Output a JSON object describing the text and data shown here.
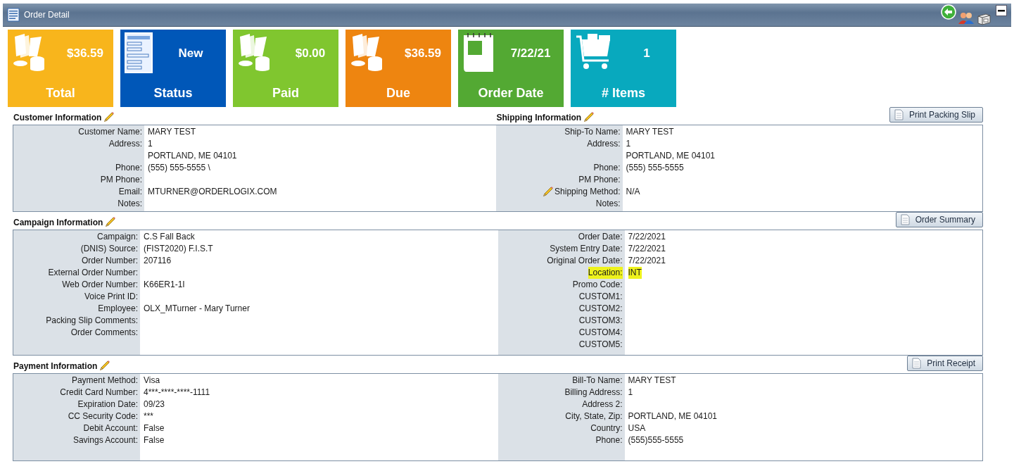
{
  "window": {
    "title": "Order Detail"
  },
  "tiles": [
    {
      "kind": "money",
      "value": "$36.59",
      "label": "Total",
      "color": "#f8b51c"
    },
    {
      "kind": "form",
      "value": "New",
      "label": "Status",
      "color": "#0057b8"
    },
    {
      "kind": "money",
      "value": "$0.00",
      "label": "Paid",
      "color": "#80c62f"
    },
    {
      "kind": "money",
      "value": "$36.59",
      "label": "Due",
      "color": "#ee8510"
    },
    {
      "kind": "calendar",
      "value": "7/22/21",
      "label": "Order Date",
      "color": "#53a933"
    },
    {
      "kind": "cart",
      "value": "1",
      "label": "# Items",
      "color": "#08a9be"
    }
  ],
  "blocks": [
    {
      "kind": "split",
      "columns": [
        {
          "title": "Customer Information",
          "fields": [
            {
              "label": "Customer Name:",
              "lines": [
                "MARY TEST"
              ],
              "editable": false,
              "highlighted": false
            },
            {
              "label": "Address:",
              "lines": [
                "1",
                "PORTLAND, ME 04101"
              ],
              "editable": false,
              "highlighted": false
            },
            {
              "label": "Phone:",
              "lines": [
                "(555) 555-5555 \\"
              ],
              "editable": false,
              "highlighted": false
            },
            {
              "label": "PM Phone:",
              "editable": false,
              "highlighted": false
            },
            {
              "label": "Email:",
              "lines": [
                "MTURNER@ORDERLOGIX.COM"
              ],
              "editable": false,
              "highlighted": false
            },
            {
              "label": "Notes:",
              "editable": false,
              "highlighted": false
            }
          ]
        },
        {
          "title": "Shipping Information",
          "button": "Print Packing Slip",
          "fields": [
            {
              "label": "Ship-To Name:",
              "lines": [
                "MARY TEST"
              ],
              "editable": false,
              "highlighted": false
            },
            {
              "label": "Address:",
              "lines": [
                "1",
                "PORTLAND, ME 04101"
              ],
              "editable": false,
              "highlighted": false
            },
            {
              "label": "Phone:",
              "lines": [
                "(555) 555-5555"
              ],
              "editable": false,
              "highlighted": false
            },
            {
              "label": "PM Phone:",
              "editable": false,
              "highlighted": false
            },
            {
              "label": "Shipping Method:",
              "lines": [
                "N/A"
              ],
              "editable": true,
              "highlighted": false
            },
            {
              "label": "Notes:",
              "editable": false,
              "highlighted": false
            }
          ]
        }
      ]
    },
    {
      "kind": "joined",
      "columns": [
        {
          "title": "Campaign Information",
          "fields": [
            {
              "label": "Campaign:",
              "lines": [
                "C.S Fall Back"
              ],
              "editable": false,
              "highlighted": false
            },
            {
              "label": "(DNIS) Source:",
              "lines": [
                "(FIST2020) F.I.S.T"
              ],
              "editable": false,
              "highlighted": false
            },
            {
              "label": "Order Number:",
              "lines": [
                "207116"
              ],
              "editable": false,
              "highlighted": false
            },
            {
              "label": "External Order Number:",
              "editable": false,
              "highlighted": false
            },
            {
              "label": "Web Order Number:",
              "lines": [
                "K66ER1-1I"
              ],
              "editable": false,
              "highlighted": false
            },
            {
              "label": "Voice Print ID:",
              "editable": false,
              "highlighted": false
            },
            {
              "label": "Employee:",
              "lines": [
                "OLX_MTurner - Mary Turner"
              ],
              "editable": false,
              "highlighted": false
            },
            {
              "label": "Packing Slip Comments:",
              "editable": false,
              "highlighted": false
            },
            {
              "label": "Order Comments:",
              "editable": false,
              "highlighted": false
            }
          ]
        },
        {
          "button": "Order Summary",
          "fields": [
            {
              "label": "Order Date:",
              "lines": [
                "7/22/2021"
              ],
              "editable": false,
              "highlighted": false
            },
            {
              "label": "System Entry Date:",
              "lines": [
                "7/22/2021"
              ],
              "editable": false,
              "highlighted": false
            },
            {
              "label": "Original Order Date:",
              "lines": [
                "7/22/2021"
              ],
              "editable": false,
              "highlighted": false
            },
            {
              "label": "Location:",
              "lines": [
                "INT"
              ],
              "editable": false,
              "highlighted": true
            },
            {
              "label": "Promo Code:",
              "editable": false,
              "highlighted": false
            },
            {
              "label": "CUSTOM1:",
              "editable": false,
              "highlighted": false
            },
            {
              "label": "CUSTOM2:",
              "editable": false,
              "highlighted": false
            },
            {
              "label": "CUSTOM3:",
              "editable": false,
              "highlighted": false
            },
            {
              "label": "CUSTOM4:",
              "editable": false,
              "highlighted": false
            },
            {
              "label": "CUSTOM5:",
              "editable": false,
              "highlighted": false
            }
          ]
        }
      ]
    },
    {
      "kind": "joined",
      "columns": [
        {
          "title": "Payment Information",
          "fields": [
            {
              "label": "Payment Method:",
              "lines": [
                "Visa"
              ],
              "editable": false,
              "highlighted": false
            },
            {
              "label": "Credit Card Number:",
              "lines": [
                "4***-****-****-1111"
              ],
              "editable": false,
              "highlighted": false
            },
            {
              "label": "Expiration Date:",
              "lines": [
                "09/23"
              ],
              "editable": false,
              "highlighted": false
            },
            {
              "label": "CC Security Code:",
              "lines": [
                "***"
              ],
              "editable": false,
              "highlighted": false
            },
            {
              "label": "Debit Account:",
              "lines": [
                "False"
              ],
              "editable": false,
              "highlighted": false
            },
            {
              "label": "Savings Account:",
              "lines": [
                "False"
              ],
              "editable": false,
              "highlighted": false
            }
          ]
        },
        {
          "button": "Print Receipt",
          "fields": [
            {
              "label": "Bill-To Name:",
              "lines": [
                "MARY TEST"
              ],
              "editable": false,
              "highlighted": false
            },
            {
              "label": "Billing Address:",
              "lines": [
                "1"
              ],
              "editable": false,
              "highlighted": false
            },
            {
              "label": "Address 2:",
              "editable": false,
              "highlighted": false
            },
            {
              "label": "City, State, Zip:",
              "lines": [
                "PORTLAND, ME 04101"
              ],
              "editable": false,
              "highlighted": false
            },
            {
              "label": "Country:",
              "lines": [
                "USA"
              ],
              "editable": false,
              "highlighted": false
            },
            {
              "label": "Phone:",
              "lines": [
                "(555)555-5555"
              ],
              "editable": false,
              "highlighted": false
            }
          ]
        }
      ]
    }
  ]
}
